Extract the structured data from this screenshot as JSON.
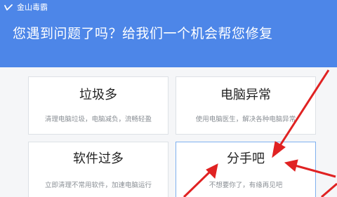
{
  "app": {
    "title": "金山毒霸",
    "logo_icon": "duba-logo-icon"
  },
  "header": {
    "headline": "您遇到问题了吗？给我们一个机会帮您修复",
    "background": "#4d86e8"
  },
  "cards": [
    {
      "title": "垃圾多",
      "desc": "清理电脑垃圾，电脑减负，流畅轻盈"
    },
    {
      "title": "电脑异常",
      "desc": "使用电脑医生，解决各种电脑异常"
    },
    {
      "title": "软件过多",
      "desc": "立即清理不常用软件，加速电脑运行"
    },
    {
      "title": "分手吧",
      "desc": "不想要你了，有缘再见吧"
    }
  ],
  "annotation": {
    "arrow_color": "#e02222",
    "icon": "red-arrow-icon"
  }
}
